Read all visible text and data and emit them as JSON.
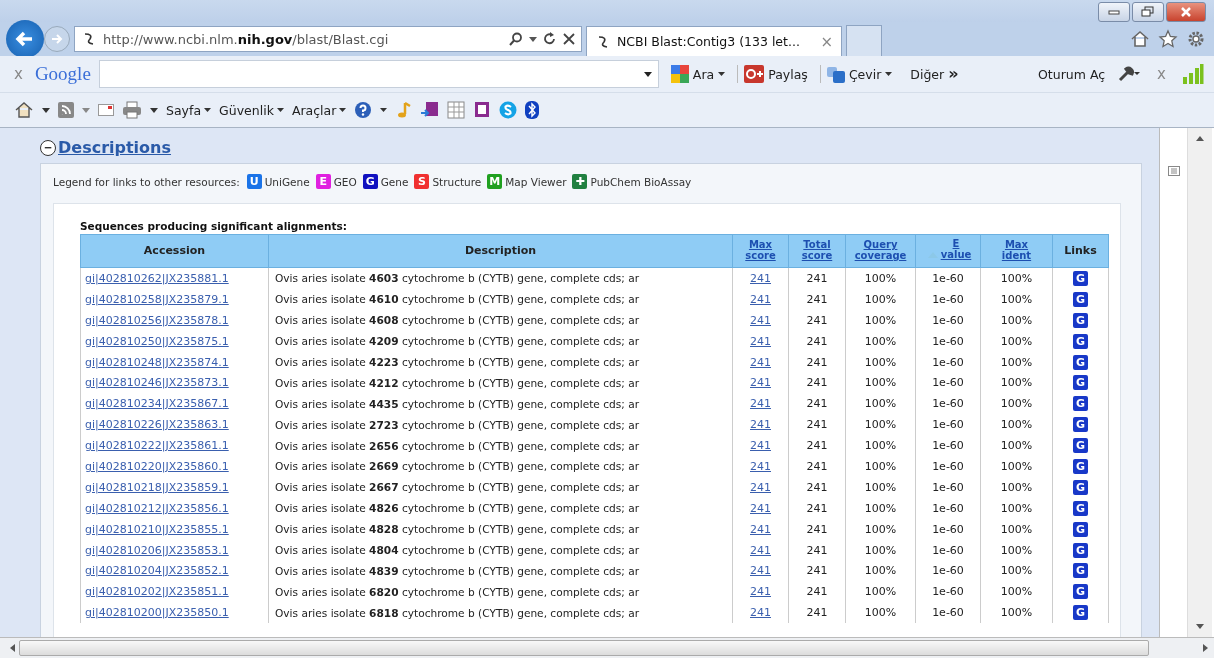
{
  "window": {
    "address": "http://www.ncbi.nlm.**nih.gov**/blast/Blast.cgi",
    "tab": {
      "title": "NCBI Blast:Contig3 (133 let...",
      "close": "×",
      "selected": true
    }
  },
  "google_bar": {
    "close": "x",
    "logo": "Google",
    "items": [
      "Ara",
      "Paylaş",
      "Çevir",
      "Diğer"
    ],
    "more": "»",
    "sign_in": "Oturum Aç",
    "close_right": "x"
  },
  "command_bar": {
    "items": [
      "Sayfa",
      "Güvenlik",
      "Araçlar"
    ]
  },
  "section": {
    "toggle": "−",
    "title": "Descriptions",
    "expanded": true
  },
  "legend": {
    "label": "Legend for links to other resources:",
    "items": [
      {
        "letter": "U",
        "name": "UniGene",
        "color": "#1a73e8"
      },
      {
        "letter": "E",
        "name": "GEO",
        "color": "#e020e0"
      },
      {
        "letter": "G",
        "name": "Gene",
        "color": "#1010c0"
      },
      {
        "letter": "S",
        "name": "Structure",
        "color": "#f03030"
      },
      {
        "letter": "M",
        "name": "Map Viewer",
        "color": "#20a020"
      },
      {
        "letter": "✚",
        "name": "PubChem BioAssay",
        "color": "#208040"
      }
    ]
  },
  "table": {
    "title": "Sequences producing significant alignments:",
    "columns": [
      {
        "label": "Accession",
        "link": false
      },
      {
        "label": "Description",
        "link": false
      },
      {
        "label": "Max score",
        "link": true
      },
      {
        "label": "Total score",
        "link": true
      },
      {
        "label": "Query coverage",
        "link": true
      },
      {
        "label": "E value",
        "link": true,
        "sorted": true
      },
      {
        "label": "Max ident",
        "link": true
      },
      {
        "label": "Links",
        "link": false
      }
    ],
    "rows": [
      {
        "accession": "gi|402810262|JX235881.1",
        "description": "Ovis aries isolate **4603** cytochrome b (CYTB) gene, complete cds; ar",
        "max_score": "241",
        "total_score": "241",
        "coverage": "100%",
        "evalue": "1e-60",
        "ident": "100%",
        "link": "G"
      },
      {
        "accession": "gi|402810258|JX235879.1",
        "description": "Ovis aries isolate **4610** cytochrome b (CYTB) gene, complete cds; ar",
        "max_score": "241",
        "total_score": "241",
        "coverage": "100%",
        "evalue": "1e-60",
        "ident": "100%",
        "link": "G"
      },
      {
        "accession": "gi|402810256|JX235878.1",
        "description": "Ovis aries isolate **4608** cytochrome b (CYTB) gene, complete cds; ar",
        "max_score": "241",
        "total_score": "241",
        "coverage": "100%",
        "evalue": "1e-60",
        "ident": "100%",
        "link": "G"
      },
      {
        "accession": "gi|402810250|JX235875.1",
        "description": "Ovis aries isolate **4209** cytochrome b (CYTB) gene, complete cds; ar",
        "max_score": "241",
        "total_score": "241",
        "coverage": "100%",
        "evalue": "1e-60",
        "ident": "100%",
        "link": "G"
      },
      {
        "accession": "gi|402810248|JX235874.1",
        "description": "Ovis aries isolate **4223** cytochrome b (CYTB) gene, complete cds; ar",
        "max_score": "241",
        "total_score": "241",
        "coverage": "100%",
        "evalue": "1e-60",
        "ident": "100%",
        "link": "G"
      },
      {
        "accession": "gi|402810246|JX235873.1",
        "description": "Ovis aries isolate **4212** cytochrome b (CYTB) gene, complete cds; ar",
        "max_score": "241",
        "total_score": "241",
        "coverage": "100%",
        "evalue": "1e-60",
        "ident": "100%",
        "link": "G"
      },
      {
        "accession": "gi|402810234|JX235867.1",
        "description": "Ovis aries isolate **4435** cytochrome b (CYTB) gene, complete cds; ar",
        "max_score": "241",
        "total_score": "241",
        "coverage": "100%",
        "evalue": "1e-60",
        "ident": "100%",
        "link": "G"
      },
      {
        "accession": "gi|402810226|JX235863.1",
        "description": "Ovis aries isolate **2723** cytochrome b (CYTB) gene, complete cds; ar",
        "max_score": "241",
        "total_score": "241",
        "coverage": "100%",
        "evalue": "1e-60",
        "ident": "100%",
        "link": "G"
      },
      {
        "accession": "gi|402810222|JX235861.1",
        "description": "Ovis aries isolate **2656** cytochrome b (CYTB) gene, complete cds; ar",
        "max_score": "241",
        "total_score": "241",
        "coverage": "100%",
        "evalue": "1e-60",
        "ident": "100%",
        "link": "G"
      },
      {
        "accession": "gi|402810220|JX235860.1",
        "description": "Ovis aries isolate **2669** cytochrome b (CYTB) gene, complete cds; ar",
        "max_score": "241",
        "total_score": "241",
        "coverage": "100%",
        "evalue": "1e-60",
        "ident": "100%",
        "link": "G"
      },
      {
        "accession": "gi|402810218|JX235859.1",
        "description": "Ovis aries isolate **2667** cytochrome b (CYTB) gene, complete cds; ar",
        "max_score": "241",
        "total_score": "241",
        "coverage": "100%",
        "evalue": "1e-60",
        "ident": "100%",
        "link": "G"
      },
      {
        "accession": "gi|402810212|JX235856.1",
        "description": "Ovis aries isolate **4826** cytochrome b (CYTB) gene, complete cds; ar",
        "max_score": "241",
        "total_score": "241",
        "coverage": "100%",
        "evalue": "1e-60",
        "ident": "100%",
        "link": "G"
      },
      {
        "accession": "gi|402810210|JX235855.1",
        "description": "Ovis aries isolate **4828** cytochrome b (CYTB) gene, complete cds; ar",
        "max_score": "241",
        "total_score": "241",
        "coverage": "100%",
        "evalue": "1e-60",
        "ident": "100%",
        "link": "G"
      },
      {
        "accession": "gi|402810206|JX235853.1",
        "description": "Ovis aries isolate **4804** cytochrome b (CYTB) gene, complete cds; ar",
        "max_score": "241",
        "total_score": "241",
        "coverage": "100%",
        "evalue": "1e-60",
        "ident": "100%",
        "link": "G"
      },
      {
        "accession": "gi|402810204|JX235852.1",
        "description": "Ovis aries isolate **4839** cytochrome b (CYTB) gene, complete cds; ar",
        "max_score": "241",
        "total_score": "241",
        "coverage": "100%",
        "evalue": "1e-60",
        "ident": "100%",
        "link": "G"
      },
      {
        "accession": "gi|402810202|JX235851.1",
        "description": "Ovis aries isolate **6820** cytochrome b (CYTB) gene, complete cds; ar",
        "max_score": "241",
        "total_score": "241",
        "coverage": "100%",
        "evalue": "1e-60",
        "ident": "100%",
        "link": "G"
      },
      {
        "accession": "gi|402810200|JX235850.1",
        "description": "Ovis aries isolate **6818** cytochrome b (CYTB) gene, complete cds; ar",
        "max_score": "241",
        "total_score": "241",
        "coverage": "100%",
        "evalue": "1e-60",
        "ident": "100%",
        "link": "G"
      }
    ]
  }
}
